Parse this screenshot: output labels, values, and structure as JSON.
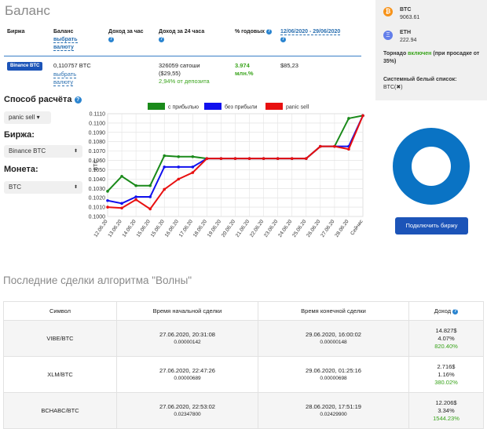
{
  "balance_section": {
    "title": "Баланс",
    "headers": {
      "exchange": "Биржа",
      "balance": "Баланс",
      "choose_currency": "выбрать валюту",
      "income_hour": "Доход за час",
      "income_24h": "Доход за 24 часа",
      "annual": "% годовых",
      "date_range": "12/06/2020 - 29/06/2020"
    },
    "row": {
      "exchange_badge": "Binance BTC",
      "balance_btc": "0,110757 BTC",
      "choose_currency": "выбрать валюту",
      "income_24h_satoshi": "326059 сатоши",
      "income_24h_usd": "($29,55)",
      "income_24h_pct": "2,94% от депозита",
      "annual_value": "3.974",
      "annual_unit": "млн.%",
      "range_value": "$85,23"
    }
  },
  "settings": {
    "calc_method_label": "Способ расчёта",
    "calc_method_value": "panic sell",
    "exchange_label": "Биржа:",
    "exchange_value": "Binance BTC",
    "coin_label": "Монета:",
    "coin_value": "BTC"
  },
  "right_panel": {
    "btc_label": "BTC",
    "btc_value": "9063.61",
    "eth_label": "ETH",
    "eth_value": "222.94",
    "tornado_text_before": "Торнадо ",
    "tornado_status": "включен",
    "tornado_text_after": " (при просадке от 35%)",
    "whitelist_label": "Системный белый список:",
    "whitelist_value": "BTC(✖)",
    "connect_button": "Подключить биржу",
    "colors": {
      "btc": "#f7931a",
      "eth": "#627eea",
      "donut": "#0a73c4",
      "button": "#1c54b8"
    }
  },
  "chart_data": {
    "type": "line",
    "ylabel": "BTC",
    "ylim": [
      0.1,
      0.111
    ],
    "yticks": [
      "0.1000",
      "0.1010",
      "0.1020",
      "0.1030",
      "0.1040",
      "0.1050",
      "0.1060",
      "0.1070",
      "0.1080",
      "0.1090",
      "0.1100",
      "0.1110"
    ],
    "categories": [
      "12.06.20",
      "13.06.20",
      "14.06.20",
      "15.06.20",
      "15.06.20",
      "16.06.20",
      "17.06.20",
      "18.06.20",
      "19.06.20",
      "20.06.20",
      "21.06.20",
      "22.06.20",
      "23.06.20",
      "24.06.20",
      "25.06.20",
      "26.06.20",
      "27.06.20",
      "28.06.20",
      "Сейчас"
    ],
    "series": [
      {
        "name": "с прибылью",
        "color": "#1a8a1a",
        "values": [
          0.1027,
          0.1043,
          0.1033,
          0.1033,
          0.1065,
          0.1064,
          0.1064,
          0.1062,
          0.1062,
          0.1062,
          0.1062,
          0.1062,
          0.1062,
          0.1062,
          0.1062,
          0.1075,
          0.1075,
          0.1105,
          0.1108
        ]
      },
      {
        "name": "без прибыли",
        "color": "#1010ee",
        "values": [
          0.1017,
          0.1014,
          0.1021,
          0.1021,
          0.1053,
          0.1053,
          0.1053,
          0.1062,
          0.1062,
          0.1062,
          0.1062,
          0.1062,
          0.1062,
          0.1062,
          0.1062,
          0.1075,
          0.1075,
          0.1075,
          0.1108
        ]
      },
      {
        "name": "panic sell",
        "color": "#e81010",
        "values": [
          0.101,
          0.1009,
          0.1018,
          0.1008,
          0.1029,
          0.104,
          0.1047,
          0.1062,
          0.1062,
          0.1062,
          0.1062,
          0.1062,
          0.1062,
          0.1062,
          0.1062,
          0.1075,
          0.1075,
          0.1072,
          0.1108
        ]
      }
    ]
  },
  "trades_section": {
    "title": "Последние сделки алгоритма \"Волны\"",
    "headers": {
      "symbol": "Символ",
      "start": "Время начальной сделки",
      "end": "Время конечной сделки",
      "income": "Доход"
    },
    "rows": [
      {
        "symbol": "VIBE/BTC",
        "start_time": "27.06.2020, 20:31:08",
        "start_price": "0.00000142",
        "end_time": "29.06.2020, 16:00:02",
        "end_price": "0.00000148",
        "income_usd": "14.827$",
        "income_pct": "4.07%",
        "income_annual": "820.40%"
      },
      {
        "symbol": "XLM/BTC",
        "start_time": "27.06.2020, 22:47:26",
        "start_price": "0.00000689",
        "end_time": "29.06.2020, 01:25:16",
        "end_price": "0.00000698",
        "income_usd": "2.716$",
        "income_pct": "1.16%",
        "income_annual": "380.02%"
      },
      {
        "symbol": "BCHABC/BTC",
        "start_time": "27.06.2020, 22:53:02",
        "start_price": "0.02347800",
        "end_time": "28.06.2020, 17:51:19",
        "end_price": "0.02429900",
        "income_usd": "12.206$",
        "income_pct": "3.34%",
        "income_annual": "1544.23%"
      }
    ]
  }
}
